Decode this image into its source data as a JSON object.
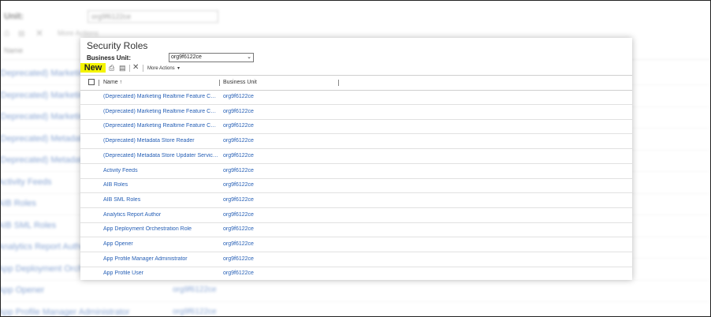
{
  "background": {
    "bu_label": "Unit:",
    "bu_value": "org9f6122ce",
    "more_actions": "More Actions",
    "header_name": "Name",
    "rows": [
      {
        "name": "(Deprecated) Marketing R",
        "bu": ""
      },
      {
        "name": "(Deprecated) Marketing R",
        "bu": ""
      },
      {
        "name": "(Deprecated) Marketing R",
        "bu": ""
      },
      {
        "name": "(Deprecated) Metadata S",
        "bu": ""
      },
      {
        "name": "(Deprecated) Metadata S",
        "bu": ""
      },
      {
        "name": "Activity Feeds",
        "bu": ""
      },
      {
        "name": "AIB Roles",
        "bu": ""
      },
      {
        "name": "AIB SML Roles",
        "bu": ""
      },
      {
        "name": "Analytics Report Author",
        "bu": ""
      },
      {
        "name": "App Deployment Orchestr",
        "bu": ""
      },
      {
        "name": "App Opener",
        "bu": "org9f6122ce"
      },
      {
        "name": "App Profile Manager Administrator",
        "bu": "org9f6122ce"
      }
    ]
  },
  "dialog": {
    "title": "Security Roles",
    "business_unit_label": "Business Unit:",
    "business_unit_value": "org9f6122ce",
    "toolbar": {
      "new_label": "New",
      "more_actions_label": "More Actions"
    },
    "columns": {
      "name": "Name ↑",
      "business_unit": "Business Unit"
    },
    "rows": [
      {
        "name": "(Deprecated) Marketing Realtime Feature Confi...",
        "bu": "org9f6122ce"
      },
      {
        "name": "(Deprecated) Marketing Realtime Feature Confi...",
        "bu": "org9f6122ce"
      },
      {
        "name": "(Deprecated) Marketing Realtime Feature Confi...",
        "bu": "org9f6122ce"
      },
      {
        "name": "(Deprecated) Metadata Store Reader",
        "bu": "org9f6122ce"
      },
      {
        "name": "(Deprecated) Metadata Store Updater Service R...",
        "bu": "org9f6122ce"
      },
      {
        "name": "Activity Feeds",
        "bu": "org9f6122ce"
      },
      {
        "name": "AIB Roles",
        "bu": "org9f6122ce"
      },
      {
        "name": "AIB SML Roles",
        "bu": "org9f6122ce"
      },
      {
        "name": "Analytics Report Author",
        "bu": "org9f6122ce"
      },
      {
        "name": "App Deployment Orchestration Role",
        "bu": "org9f6122ce"
      },
      {
        "name": "App Opener",
        "bu": "org9f6122ce"
      },
      {
        "name": "App Profile Manager Administrator",
        "bu": "org9f6122ce"
      },
      {
        "name": "App Profile User",
        "bu": "org9f6122ce"
      }
    ]
  },
  "icons": {
    "print": "print-icon",
    "export": "export-icon",
    "delete": "delete-icon",
    "dropdown": "chevron-down-icon"
  }
}
